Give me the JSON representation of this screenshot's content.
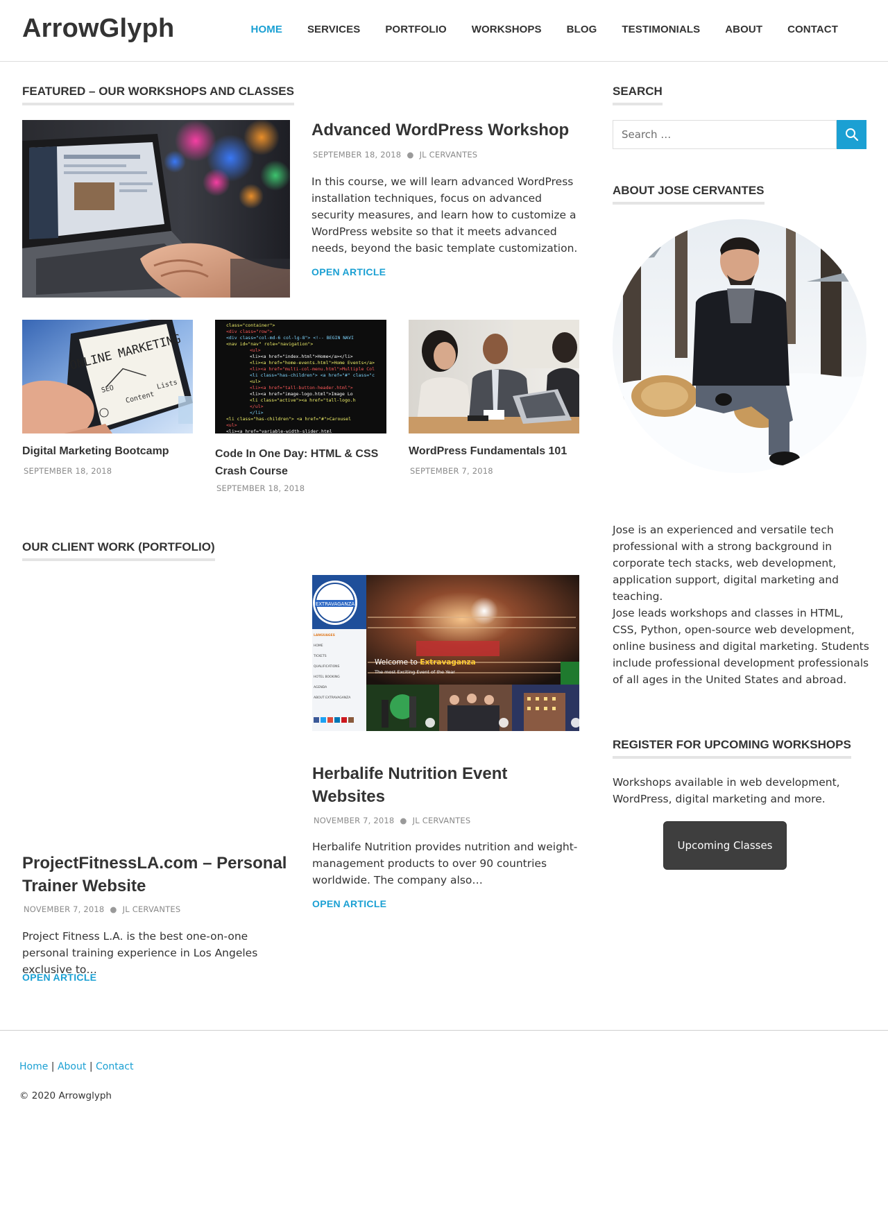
{
  "site": {
    "title": "ArrowGlyph"
  },
  "nav": {
    "items": [
      {
        "label": "HOME"
      },
      {
        "label": "SERVICES"
      },
      {
        "label": "PORTFOLIO"
      },
      {
        "label": "WORKSHOPS"
      },
      {
        "label": "BLOG"
      },
      {
        "label": "TESTIMONIALS"
      },
      {
        "label": "ABOUT"
      },
      {
        "label": "CONTACT"
      }
    ],
    "active": "HOME",
    "accent_color": "#1ba0d3"
  },
  "featured": {
    "heading": "FEATURED – OUR WORKSHOPS AND CLASSES",
    "main_post": {
      "title": "Advanced WordPress Workshop",
      "date": "SEPTEMBER 18, 2018",
      "author": "JL CERVANTES",
      "excerpt": "In this course, we will learn advanced WordPress installation techniques, focus on advanced security measures, and learn how to customize a WordPress website so that it meets advanced needs, beyond the basic template customization.",
      "link_label": "OPEN ARTICLE"
    },
    "small_posts": [
      {
        "title": "Digital Marketing Bootcamp",
        "date": "SEPTEMBER 18, 2018"
      },
      {
        "title": "Code In One Day: HTML & CSS Crash Course",
        "date": "SEPTEMBER 18, 2018"
      },
      {
        "title": "WordPress Fundamentals 101",
        "date": "SEPTEMBER 7, 2018"
      }
    ],
    "marketing_image_text": "ONLINE MARKETING",
    "code_image_lines": [
      "class=\"container\">",
      "<div class=\"row\">",
      "<div class=\"col-md-6 col-lg-8\"> <!-- BEGIN NAVI",
      "<nav id=\"nav\" role=\"navigation\">",
      "<ul>",
      "<li><a href=\"index.html\">Home</a></li>",
      "<li><a href=\"home-events.html\">Home Events</a>",
      "<li><a href=\"multi-col-menu.html\">Multiple Col",
      "<li class=\"has-children\"> <a href=\"#\" class=\"c",
      "<ul>",
      "<li><a href=\"tall-button-header.html\">",
      "<li><a href=\"image-logo.html\">Image Lo",
      "<li class=\"active\"><a href=\"tall-logo.h",
      "</ul>",
      "</li>",
      "<li class=\"has-children\"> <a href=\"#\">Carousel",
      "<ul>",
      "<li><a href=\"variable-width-slider.html"
    ]
  },
  "portfolio": {
    "heading": "OUR CLIENT WORK (PORTFOLIO)",
    "posts": [
      {
        "title": "ProjectFitnessLA.com – Personal Trainer Website",
        "date": "NOVEMBER 7, 2018",
        "author": "JL CERVANTES",
        "excerpt": "Project Fitness L.A. is the best one-on-one personal training experience in Los Angeles exclusive to…",
        "link_label": "OPEN ARTICLE"
      },
      {
        "title": "Herbalife Nutrition Event Websites",
        "date": "NOVEMBER 7, 2018",
        "author": "JL CERVANTES",
        "excerpt": "Herbalife Nutrition provides nutrition and weight-management products to over 90 countries worldwide. The company also…",
        "link_label": "OPEN ARTICLE"
      }
    ],
    "extravaganza": {
      "logo_text": "EXTRAVAGANZA",
      "welcome": "Welcome to",
      "brand": "Extravaganza",
      "tagline": "The most Exciting Event of the Year",
      "menu": [
        "LANGUAGES",
        "HOME",
        "TICKETS",
        "QUALIFICATIONS",
        "HOTEL BOOKING",
        "AGENDA",
        "ABOUT EXTRAVAGANZA"
      ]
    }
  },
  "sidebar": {
    "search_heading": "SEARCH",
    "search_placeholder": "Search …",
    "about_heading": "ABOUT JOSE CERVANTES",
    "about_paragraphs": [
      "Jose is an experienced and versatile tech professional with a strong background in corporate tech stacks, web development, application support, digital marketing and teaching.",
      "Jose leads workshops and classes in HTML, CSS, Python, open-source web development, online business and digital marketing. Students include professional development professionals of all ages in the United States and abroad."
    ],
    "register_heading": "REGISTER FOR UPCOMING WORKSHOPS",
    "register_text": "Workshops available in web development, WordPress, digital marketing and more.",
    "cta_label": "Upcoming Classes"
  },
  "footer": {
    "links": [
      {
        "label": "Home"
      },
      {
        "label": "About"
      },
      {
        "label": "Contact"
      }
    ],
    "separator": "|",
    "copyright": "© 2020 Arrowglyph"
  }
}
